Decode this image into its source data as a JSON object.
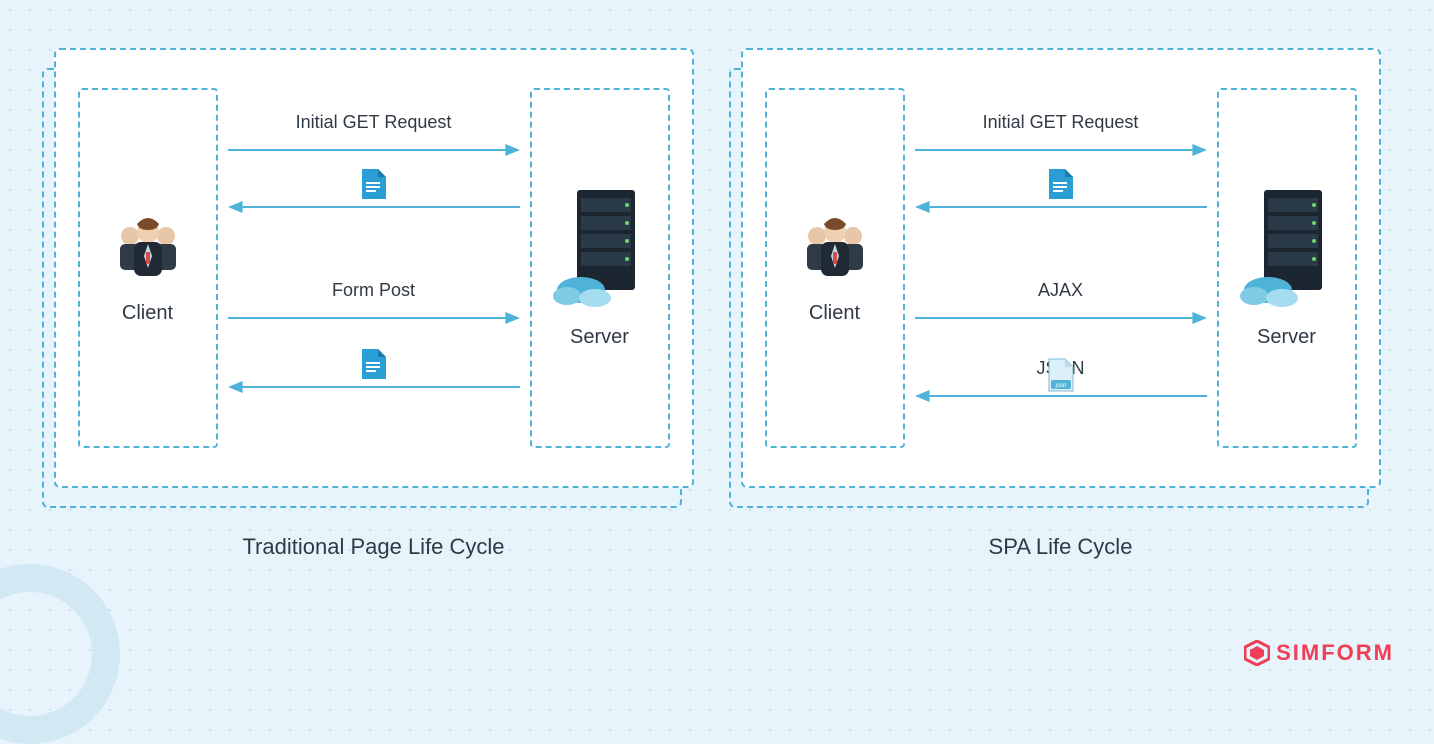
{
  "panels": [
    {
      "client_label": "Client",
      "server_label": "Server",
      "caption": "Traditional Page Life Cycle",
      "arrows": [
        {
          "label": "Initial GET Request",
          "dir": "right",
          "payload": null
        },
        {
          "label": "",
          "dir": "left",
          "payload": "doc"
        },
        {
          "label": "Form Post",
          "dir": "right",
          "payload": null
        },
        {
          "label": "",
          "dir": "left",
          "payload": "doc"
        }
      ]
    },
    {
      "client_label": "Client",
      "server_label": "Server",
      "caption": "SPA Life Cycle",
      "arrows": [
        {
          "label": "Initial GET Request",
          "dir": "right",
          "payload": null
        },
        {
          "label": "",
          "dir": "left",
          "payload": "doc"
        },
        {
          "label": "AJAX",
          "dir": "right",
          "payload": null
        },
        {
          "label": "JSON",
          "dir": "left",
          "payload": "json"
        }
      ]
    }
  ],
  "logo_text": "SIMFORM",
  "colors": {
    "accent": "#4fb3d9",
    "text": "#303a45",
    "brand": "#ef3e56"
  }
}
